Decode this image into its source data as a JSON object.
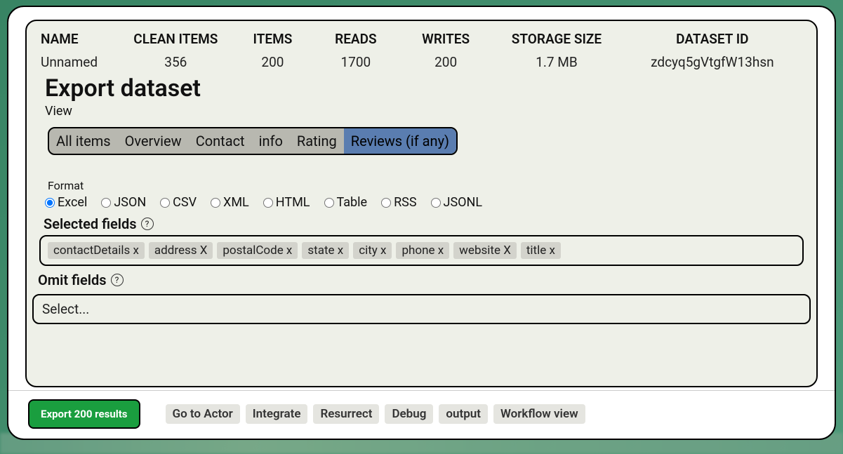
{
  "stats": {
    "name": {
      "label": "NAME",
      "value": "Unnamed"
    },
    "clean": {
      "label": "CLEAN ITEMS",
      "value": "356"
    },
    "items": {
      "label": "ITEMS",
      "value": "200"
    },
    "reads": {
      "label": "READS",
      "value": "1700"
    },
    "writes": {
      "label": "WRITES",
      "value": "200"
    },
    "storage": {
      "label": "STORAGE SIZE",
      "value": "1.7 MB"
    },
    "dataset": {
      "label": "DATASET ID",
      "value": "zdcyq5gVtgfW13hsn"
    }
  },
  "title": "Export dataset",
  "view_label": "View",
  "tabs": {
    "all": "All items",
    "overview": "Overview",
    "contact": "Contact",
    "info": "info",
    "rating": "Rating",
    "reviews": "Reviews (if any)"
  },
  "format": {
    "label": "Format",
    "options": {
      "excel": "Excel",
      "json": "JSON",
      "csv": "CSV",
      "xml": "XML",
      "html": "HTML",
      "table": "Table",
      "rss": "RSS",
      "jsonl": "JSONL"
    }
  },
  "selected_fields": {
    "label": "Selected fields",
    "chips": {
      "c0": "contactDetails x",
      "c1": "address X",
      "c2": "postalCode x",
      "c3": "state x",
      "c4": "city x",
      "c5": "phone x",
      "c6": "website X",
      "c7": "title x"
    }
  },
  "omit_fields": {
    "label": "Omit fields",
    "placeholder": "Select..."
  },
  "footer": {
    "export": "Export 200 results",
    "goto": "Go to Actor",
    "integrate": "Integrate",
    "resurrect": "Resurrect",
    "debug": "Debug",
    "output": "output",
    "workflow": "Workflow view"
  },
  "help": "?"
}
